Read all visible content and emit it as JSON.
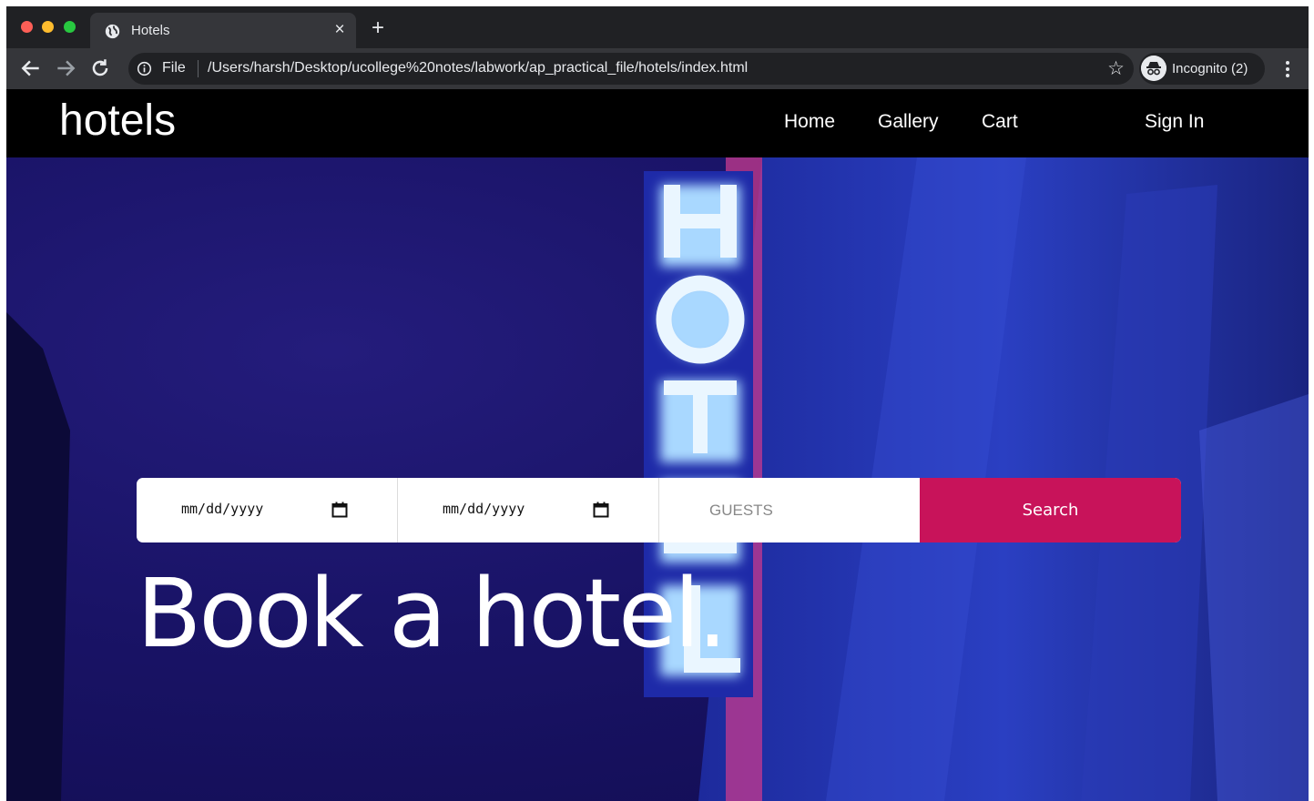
{
  "browser": {
    "tab": {
      "title": "Hotels",
      "close_glyph": "×",
      "favicon": "globe-icon"
    },
    "new_tab_glyph": "+",
    "address": {
      "scheme": "File",
      "url": "/Users/harsh/Desktop/ucollege%20notes/labwork/ap_practical_file/hotels/index.html"
    },
    "bookmark_glyph": "☆",
    "incognito_label": "Incognito (2)",
    "colors": {
      "chrome_dark": "#202124",
      "chrome_toolbar": "#35363a"
    }
  },
  "site": {
    "logo": "hotels",
    "nav": {
      "home": "Home",
      "gallery": "Gallery",
      "cart": "Cart",
      "signin": "Sign In"
    },
    "search": {
      "checkin_placeholder": "mm/dd/yyyy",
      "checkout_placeholder": "mm/dd/yyyy",
      "guests_placeholder": "GUESTS",
      "button_label": "Search"
    },
    "headline": "Book a hotel.",
    "colors": {
      "accent": "#c8135a",
      "hero_bg": "#191366",
      "nav_bg": "#000000"
    }
  }
}
